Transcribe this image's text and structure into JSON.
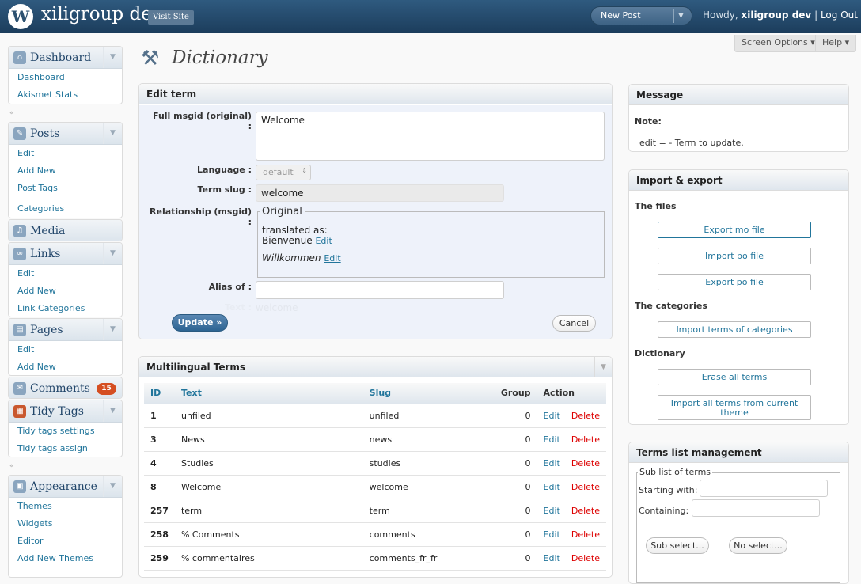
{
  "header": {
    "logo": "W",
    "site_title": "xiligroup dev",
    "visit_site": "Visit Site",
    "new_post": "New Post",
    "howdy": "Howdy,",
    "user": "xiligroup dev",
    "separator": "|",
    "logout": "Log Out"
  },
  "top_tabs": {
    "screen_options": "Screen Options ▾",
    "help": "Help ▾"
  },
  "page": {
    "title": "Dictionary"
  },
  "sidebar": {
    "dashboard": {
      "label": "Dashboard",
      "items": [
        "Dashboard",
        "Akismet Stats"
      ]
    },
    "posts": {
      "label": "Posts",
      "items": [
        "Edit",
        "Add New",
        "Post Tags",
        "Categories"
      ]
    },
    "media": {
      "label": "Media"
    },
    "links": {
      "label": "Links",
      "items": [
        "Edit",
        "Add New",
        "Link Categories"
      ]
    },
    "pages": {
      "label": "Pages",
      "items": [
        "Edit",
        "Add New"
      ]
    },
    "comments": {
      "label": "Comments",
      "count": "15"
    },
    "tidy_tags": {
      "label": "Tidy Tags",
      "items": [
        "Tidy tags settings",
        "Tidy tags assign"
      ]
    },
    "appearance": {
      "label": "Appearance",
      "items": [
        "Themes",
        "Widgets",
        "Editor",
        "Add New Themes"
      ]
    }
  },
  "edit_term": {
    "heading": "Edit term",
    "msgid_label": "Full msgid (original) :",
    "msgid_value": "Welcome",
    "language_label": "Language :",
    "language_value": "default",
    "slug_label": "Term slug :",
    "slug_value": "welcome",
    "relationship_label": "Relationship (msgid) :",
    "relationship_legend": "Original",
    "translated_as": "translated as:",
    "translations": [
      {
        "text": "Bienvenue",
        "edit": "Edit"
      },
      {
        "text": "Willkommen",
        "edit": "Edit"
      }
    ],
    "alias_label": "Alias of :",
    "alias_value": "",
    "text_label": "Text :",
    "text_value": "welcome",
    "update_button": "Update »",
    "cancel_button": "Cancel"
  },
  "multilingual_terms": {
    "heading": "Multilingual Terms",
    "columns": [
      "ID",
      "Text",
      "Slug",
      "Group",
      "Action"
    ],
    "rows": [
      {
        "id": "1",
        "text": "unfiled",
        "slug": "unfiled",
        "group": "0",
        "edit": "Edit",
        "delete": "Delete"
      },
      {
        "id": "3",
        "text": "News",
        "slug": "news",
        "group": "0",
        "edit": "Edit",
        "delete": "Delete"
      },
      {
        "id": "4",
        "text": "Studies",
        "slug": "studies",
        "group": "0",
        "edit": "Edit",
        "delete": "Delete"
      },
      {
        "id": "8",
        "text": "Welcome",
        "slug": "welcome",
        "group": "0",
        "edit": "Edit",
        "delete": "Delete"
      },
      {
        "id": "257",
        "text": "term",
        "slug": "term",
        "group": "0",
        "edit": "Edit",
        "delete": "Delete"
      },
      {
        "id": "258",
        "text": "% Comments",
        "slug": "comments",
        "group": "0",
        "edit": "Edit",
        "delete": "Delete"
      },
      {
        "id": "259",
        "text": "% commentaires",
        "slug": "comments_fr_fr",
        "group": "0",
        "edit": "Edit",
        "delete": "Delete"
      }
    ]
  },
  "message": {
    "heading": "Message",
    "note_label": "Note:",
    "note_text": "edit = - Term to update."
  },
  "import_export": {
    "heading": "Import & export",
    "files_heading": "The files",
    "export_mo": "Export mo file",
    "import_po": "Import po file",
    "export_po": "Export po file",
    "categories_heading": "The categories",
    "import_categories": "Import terms of categories",
    "dictionary_heading": "Dictionary",
    "erase_all": "Erase all terms",
    "import_theme": "Import all terms from current theme"
  },
  "terms_list": {
    "heading": "Terms list management",
    "legend": "Sub list of terms",
    "starting_with_label": "Starting with:",
    "containing_label": "Containing:",
    "sub_select": "Sub select...",
    "no_select": "No select..."
  },
  "colors": {
    "header_bg": "#23466a",
    "link": "#21759b",
    "delete": "#dd0000",
    "badge": "#d54e21"
  }
}
